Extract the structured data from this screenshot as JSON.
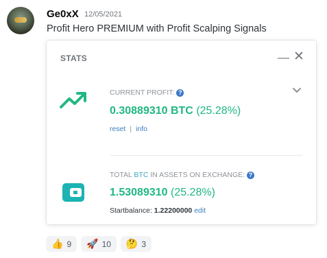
{
  "message": {
    "username": "Ge0xX",
    "timestamp": "12/05/2021",
    "text": "Profit Hero PREMIUM with Profit Scalping Signals"
  },
  "embed": {
    "title": "STATS",
    "profit": {
      "label": "CURRENT PROFIT:",
      "amount": "0.30889310 BTC",
      "percent": "(25.28%)",
      "reset_link": "reset",
      "info_link": "info",
      "separator": "|",
      "icon": "trend-up-icon"
    },
    "assets": {
      "label_prefix": "TOTAL",
      "label_accent": "BTC",
      "label_suffix": "IN ASSETS ON EXCHANGE:",
      "amount": "1.53089310",
      "percent": "(25.28%)",
      "startbalance_label": "Startbalance:",
      "startbalance_value": "1.22200000",
      "edit_link": "edit",
      "icon": "wallet-icon"
    },
    "help_glyph": "?",
    "minimize_glyph": "—",
    "close_glyph": "✕"
  },
  "reactions": [
    {
      "emoji": "👍",
      "count": "9"
    },
    {
      "emoji": "🚀",
      "count": "10"
    },
    {
      "emoji": "🤔",
      "count": "3"
    }
  ],
  "colors": {
    "accent_green": "#1fb881",
    "teal_icon": "#1bb3b3",
    "link_blue": "#3c7fbf",
    "help_blue": "#3a78c8",
    "muted_text": "#8e9297"
  }
}
